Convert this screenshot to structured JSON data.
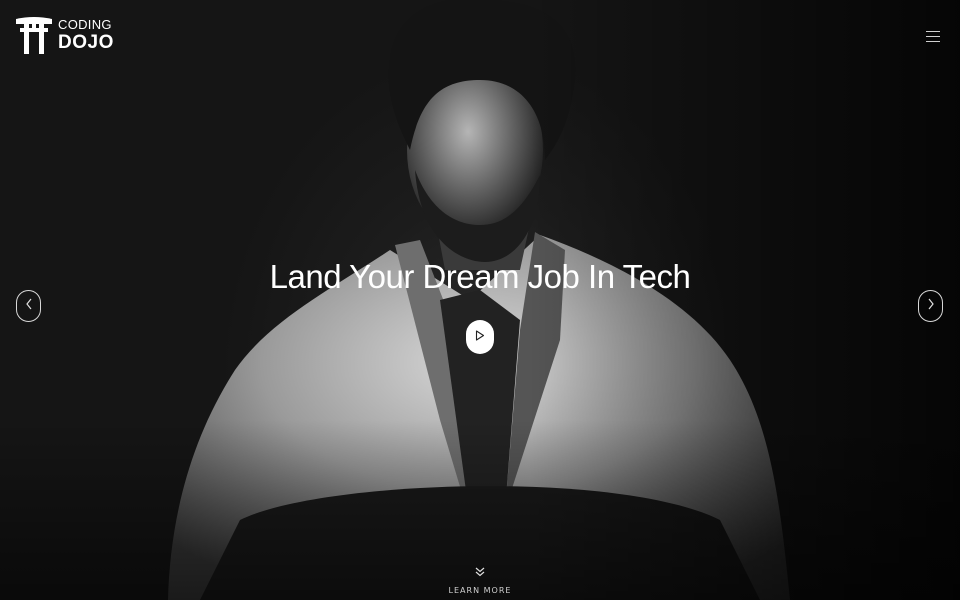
{
  "header": {
    "logo": {
      "line1": "CODING",
      "line2": "DOJO",
      "icon": "torii-gate-icon"
    },
    "menu_icon": "hamburger-menu-icon"
  },
  "hero": {
    "headline": "Land Your Dream Job In Tech",
    "play_icon": "play-icon",
    "prev_icon": "chevron-left-icon",
    "next_icon": "chevron-right-icon",
    "learn_more_label": "LEARN MORE",
    "learn_more_icon": "double-chevron-down-icon"
  },
  "colors": {
    "background": "#141414",
    "text": "#ffffff",
    "muted_text": "#cfcfcf"
  }
}
